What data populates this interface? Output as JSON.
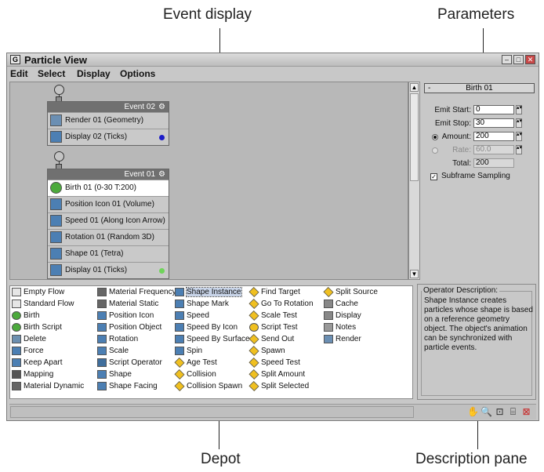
{
  "callouts": {
    "event_display": "Event display",
    "parameters": "Parameters",
    "depot": "Depot",
    "description_pane": "Description pane"
  },
  "window": {
    "title": "Particle View",
    "menu": [
      "Edit",
      "Select",
      "Display",
      "Options"
    ]
  },
  "events": [
    {
      "title": "Event 02",
      "operators": [
        {
          "label": "Render 01 (Geometry)",
          "icon": "render-icon"
        },
        {
          "label": "Display 02 (Ticks)",
          "icon": "display-icon",
          "dot_color": "#1c1cc8"
        }
      ]
    },
    {
      "title": "Event 01",
      "operators": [
        {
          "label": "Birth 01 (0-30 T:200)",
          "icon": "birth-icon"
        },
        {
          "label": "Position Icon 01 (Volume)",
          "icon": "position-icon"
        },
        {
          "label": "Speed 01 (Along Icon Arrow)",
          "icon": "speed-icon"
        },
        {
          "label": "Rotation 01 (Random 3D)",
          "icon": "rotation-icon"
        },
        {
          "label": "Shape 01 (Tetra)",
          "icon": "shape-icon"
        },
        {
          "label": "Display 01 (Ticks)",
          "icon": "display-icon",
          "dot_color": "#6fd45a"
        }
      ]
    }
  ],
  "parameters": {
    "rollout_title": "Birth 01",
    "rollout_toggle": "-",
    "emit_start_label": "Emit Start:",
    "emit_start_value": "0",
    "emit_stop_label": "Emit Stop:",
    "emit_stop_value": "30",
    "amount_label": "Amount:",
    "amount_value": "200",
    "rate_label": "Rate:",
    "rate_value": "60.0",
    "total_label": "Total:",
    "total_value": "200",
    "subframe_label": "Subframe Sampling"
  },
  "depot": {
    "columns": [
      [
        "Empty Flow",
        "Standard Flow",
        "Birth",
        "Birth Script",
        "Delete",
        "Force",
        "Keep Apart",
        "Mapping",
        "Material Dynamic"
      ],
      [
        "Material Frequency",
        "Material Static",
        "Position Icon",
        "Position Object",
        "Rotation",
        "Scale",
        "Script Operator",
        "Shape",
        "Shape Facing"
      ],
      [
        "Shape Instance",
        "Shape Mark",
        "Speed",
        "Speed By Icon",
        "Speed By Surface",
        "Spin",
        "Age Test",
        "Collision",
        "Collision Spawn"
      ],
      [
        "Find Target",
        "Go To Rotation",
        "Scale Test",
        "Script Test",
        "Send Out",
        "Spawn",
        "Speed Test",
        "Split Amount",
        "Split Selected"
      ],
      [
        "Split Source",
        "Cache",
        "Display",
        "Notes",
        "Render"
      ]
    ],
    "selected": "Shape Instance"
  },
  "description": {
    "legend": "Operator Description:",
    "text": "Shape Instance creates particles whose shape is based on a reference geometry object. The object's animation can be synchronized with particle events."
  },
  "colors": {
    "window_bg": "#c8c8c8",
    "graph_bg": "#b8b8b8",
    "event_header": "#707070",
    "selected_op": "#ffffff"
  }
}
